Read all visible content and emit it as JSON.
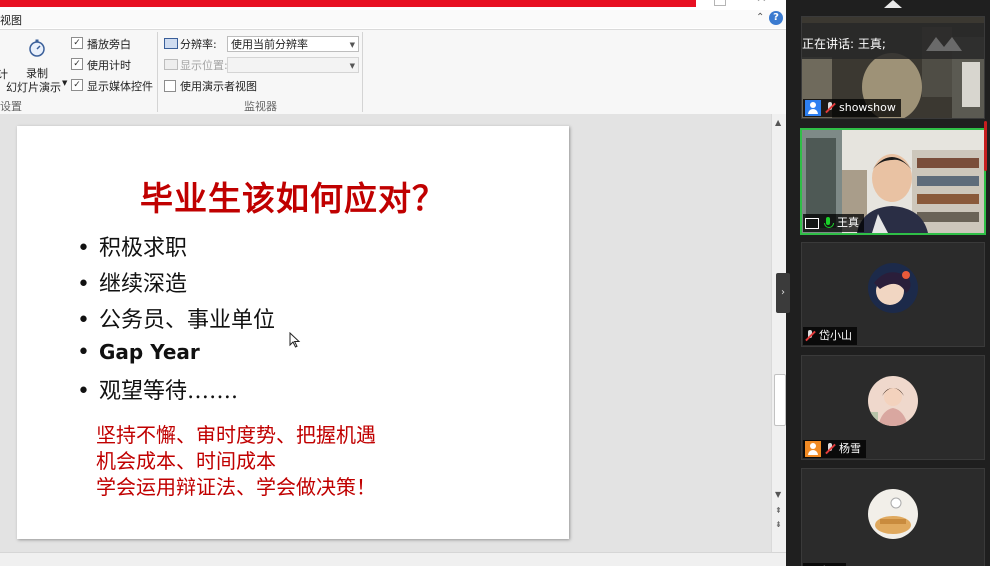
{
  "ribbon": {
    "menu_view": "视图",
    "record_label": "录制",
    "record_sub": "幻灯片演示",
    "cut_label": "计",
    "checkboxes": [
      {
        "label": "播放旁白",
        "checked": true
      },
      {
        "label": "使用计时",
        "checked": true
      },
      {
        "label": "显示媒体控件",
        "checked": true
      }
    ],
    "group_setup": "设置",
    "resolution_label": "分辨率:",
    "resolution_value": "使用当前分辨率",
    "display_label": "显示位置:",
    "display_value": "",
    "presenter_view_label": "使用演示者视图",
    "presenter_view_checked": false,
    "group_monitor": "监视器",
    "check_glyph": "✓"
  },
  "slide": {
    "title": "毕业生该如何应对？",
    "bullets": [
      "积极求职",
      "继续深造",
      "公务员、事业单位",
      "Gap Year",
      "观望等待……."
    ],
    "red_lines": [
      "坚持不懈、审时度势、把握机遇",
      "机会成本、时间成本",
      "学会运用辩证法、学会做决策！"
    ]
  },
  "meeting": {
    "speaking_text": "正在讲话: 王真;",
    "participants": [
      {
        "name": "showshow",
        "muted": true,
        "video": true
      },
      {
        "name": "王真",
        "muted": false,
        "video": true,
        "sharing": true
      },
      {
        "name": "岱小山",
        "muted": true,
        "video": false
      },
      {
        "name": "杨雪",
        "muted": true,
        "video": false
      },
      {
        "name": "穷人",
        "muted": true,
        "video": false
      }
    ]
  },
  "colors": {
    "slide_red": "#c00000",
    "active_border": "#2fbf47",
    "accent_blue": "#2d7ff0"
  }
}
